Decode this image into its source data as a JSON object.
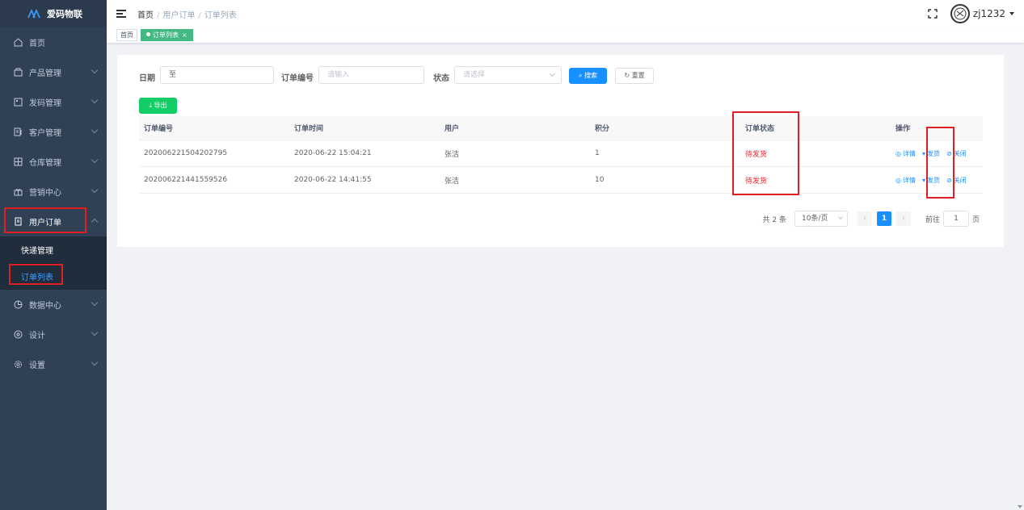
{
  "app": {
    "title": "爱码物联",
    "accent": "#1890ff",
    "sidebar_bg": "#304156"
  },
  "sidebar": {
    "items": [
      {
        "label": "首页",
        "icon": "home-icon"
      },
      {
        "label": "产品管理",
        "icon": "box-icon"
      },
      {
        "label": "发码管理",
        "icon": "qrcode-icon"
      },
      {
        "label": "客户管理",
        "icon": "contacts-icon"
      },
      {
        "label": "仓库管理",
        "icon": "warehouse-icon"
      },
      {
        "label": "营销中心",
        "icon": "marketing-icon"
      },
      {
        "label": "用户订单",
        "icon": "order-icon"
      },
      {
        "label": "数据中心",
        "icon": "chart-icon"
      },
      {
        "label": "设计",
        "icon": "design-icon"
      },
      {
        "label": "设置",
        "icon": "settings-icon"
      }
    ],
    "submenu": [
      {
        "label": "快递管理"
      },
      {
        "label": "订单列表"
      }
    ]
  },
  "header": {
    "breadcrumb": [
      "首页",
      "用户订单",
      "订单列表"
    ],
    "username": "zj1232"
  },
  "tags": {
    "home": "首页",
    "active": "订单列表",
    "close": "×"
  },
  "filters": {
    "date_label": "日期",
    "date_separator": "至",
    "order_no_label": "订单编号",
    "order_no_placeholder": "请输入",
    "status_label": "状态",
    "status_placeholder": "请选择",
    "search_button": "搜索",
    "reset_button": "重置",
    "export_button": "导出"
  },
  "table": {
    "columns": [
      "订单编号",
      "订单时间",
      "用户",
      "积分",
      "订单状态",
      "操作"
    ],
    "rows": [
      {
        "order_no": "202006221504202795",
        "time": "2020-06-22 15:04:21",
        "user": "张洁",
        "points": "1",
        "status": "待发货"
      },
      {
        "order_no": "202006221441559526",
        "time": "2020-06-22 14:41:55",
        "user": "张洁",
        "points": "10",
        "status": "待发货"
      }
    ],
    "actions": [
      "详情",
      "发货",
      "关闭"
    ]
  },
  "pagination": {
    "total": "共 2 条",
    "page_size": "10条/页",
    "current": "1",
    "goto_label": "前往",
    "goto_value": "1",
    "page_suffix": "页"
  }
}
